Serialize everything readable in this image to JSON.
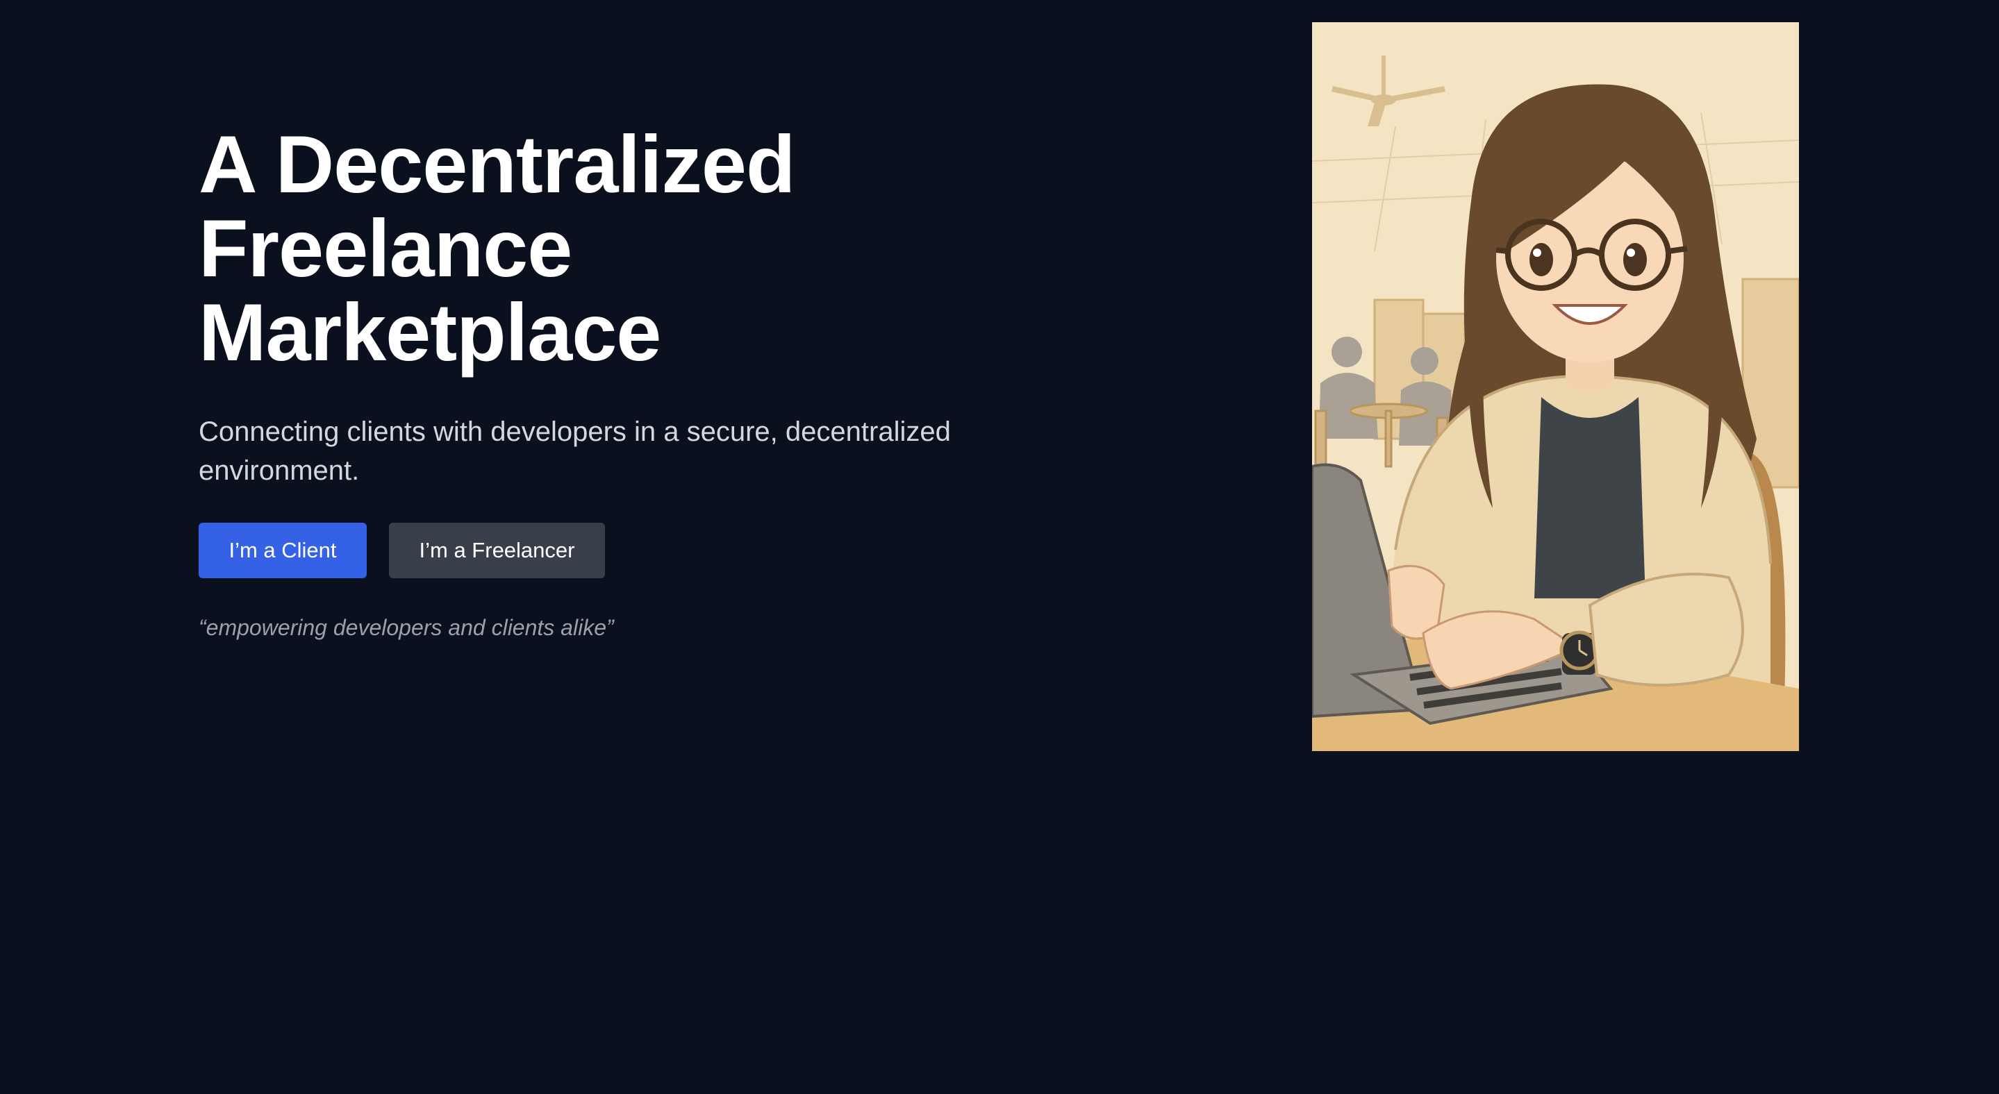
{
  "hero": {
    "headline_lines": [
      "A Decentralized",
      "Freelance",
      "Marketplace"
    ],
    "subtitle": "Connecting clients with developers in a secure, decentralized environment.",
    "tagline": "“empowering developers and clients alike”"
  },
  "actions": {
    "client_label": "I’m a Client",
    "freelancer_label": "I’m a Freelancer"
  },
  "illustration": {
    "subject": "woman-with-glasses-typing-on-laptop"
  },
  "colors": {
    "background": "#0b101f",
    "primary_button": "#3461e6",
    "secondary_button": "#393e4b",
    "illustration_bg": "#f3e2c0"
  }
}
